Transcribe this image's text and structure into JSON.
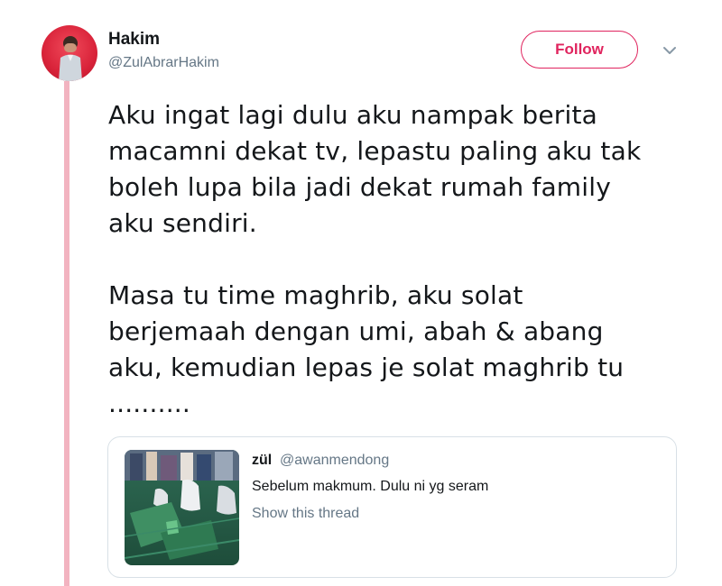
{
  "tweet": {
    "author": {
      "name": "Hakim",
      "handle": "@ZulAbrarHakim"
    },
    "follow_label": "Follow",
    "paragraphs": [
      [
        "Aku ingat lagi dulu aku nampak berita",
        "macamni dekat tv, lepastu paling aku tak",
        "boleh lupa bila jadi dekat rumah family",
        "aku sendiri."
      ],
      [
        "Masa tu time maghrib, aku solat",
        "berjemaah dengan umi, abah & abang",
        "aku, kemudian lepas je solat maghrib tu",
        ".........."
      ]
    ]
  },
  "quoted_tweet": {
    "name": "zül",
    "handle": "@awanmendong",
    "text": "Sebelum makmum. Dulu ni yg seram",
    "show_thread_label": "Show this thread"
  },
  "colors": {
    "accent": "#e0245e",
    "thread_line": "#f2b3c0",
    "secondary_text": "#657786",
    "border": "#d8e0e6"
  },
  "icons": {
    "menu": "chevron-down-icon",
    "avatar": "avatar-photo",
    "thumbnail": "quoted-media-thumbnail"
  }
}
